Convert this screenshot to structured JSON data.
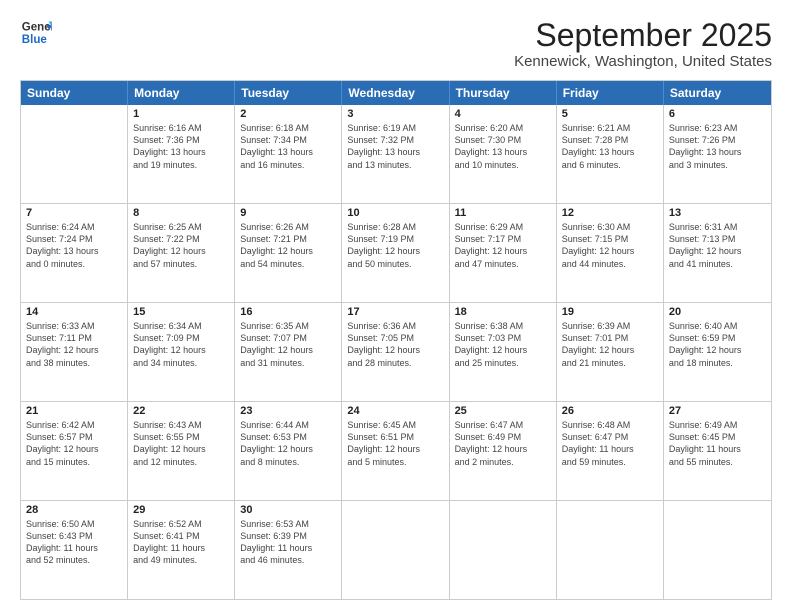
{
  "logo": {
    "general": "General",
    "blue": "Blue"
  },
  "header": {
    "month": "September 2025",
    "location": "Kennewick, Washington, United States"
  },
  "weekdays": [
    "Sunday",
    "Monday",
    "Tuesday",
    "Wednesday",
    "Thursday",
    "Friday",
    "Saturday"
  ],
  "rows": [
    [
      {
        "day": "",
        "lines": []
      },
      {
        "day": "1",
        "lines": [
          "Sunrise: 6:16 AM",
          "Sunset: 7:36 PM",
          "Daylight: 13 hours",
          "and 19 minutes."
        ]
      },
      {
        "day": "2",
        "lines": [
          "Sunrise: 6:18 AM",
          "Sunset: 7:34 PM",
          "Daylight: 13 hours",
          "and 16 minutes."
        ]
      },
      {
        "day": "3",
        "lines": [
          "Sunrise: 6:19 AM",
          "Sunset: 7:32 PM",
          "Daylight: 13 hours",
          "and 13 minutes."
        ]
      },
      {
        "day": "4",
        "lines": [
          "Sunrise: 6:20 AM",
          "Sunset: 7:30 PM",
          "Daylight: 13 hours",
          "and 10 minutes."
        ]
      },
      {
        "day": "5",
        "lines": [
          "Sunrise: 6:21 AM",
          "Sunset: 7:28 PM",
          "Daylight: 13 hours",
          "and 6 minutes."
        ]
      },
      {
        "day": "6",
        "lines": [
          "Sunrise: 6:23 AM",
          "Sunset: 7:26 PM",
          "Daylight: 13 hours",
          "and 3 minutes."
        ]
      }
    ],
    [
      {
        "day": "7",
        "lines": [
          "Sunrise: 6:24 AM",
          "Sunset: 7:24 PM",
          "Daylight: 13 hours",
          "and 0 minutes."
        ]
      },
      {
        "day": "8",
        "lines": [
          "Sunrise: 6:25 AM",
          "Sunset: 7:22 PM",
          "Daylight: 12 hours",
          "and 57 minutes."
        ]
      },
      {
        "day": "9",
        "lines": [
          "Sunrise: 6:26 AM",
          "Sunset: 7:21 PM",
          "Daylight: 12 hours",
          "and 54 minutes."
        ]
      },
      {
        "day": "10",
        "lines": [
          "Sunrise: 6:28 AM",
          "Sunset: 7:19 PM",
          "Daylight: 12 hours",
          "and 50 minutes."
        ]
      },
      {
        "day": "11",
        "lines": [
          "Sunrise: 6:29 AM",
          "Sunset: 7:17 PM",
          "Daylight: 12 hours",
          "and 47 minutes."
        ]
      },
      {
        "day": "12",
        "lines": [
          "Sunrise: 6:30 AM",
          "Sunset: 7:15 PM",
          "Daylight: 12 hours",
          "and 44 minutes."
        ]
      },
      {
        "day": "13",
        "lines": [
          "Sunrise: 6:31 AM",
          "Sunset: 7:13 PM",
          "Daylight: 12 hours",
          "and 41 minutes."
        ]
      }
    ],
    [
      {
        "day": "14",
        "lines": [
          "Sunrise: 6:33 AM",
          "Sunset: 7:11 PM",
          "Daylight: 12 hours",
          "and 38 minutes."
        ]
      },
      {
        "day": "15",
        "lines": [
          "Sunrise: 6:34 AM",
          "Sunset: 7:09 PM",
          "Daylight: 12 hours",
          "and 34 minutes."
        ]
      },
      {
        "day": "16",
        "lines": [
          "Sunrise: 6:35 AM",
          "Sunset: 7:07 PM",
          "Daylight: 12 hours",
          "and 31 minutes."
        ]
      },
      {
        "day": "17",
        "lines": [
          "Sunrise: 6:36 AM",
          "Sunset: 7:05 PM",
          "Daylight: 12 hours",
          "and 28 minutes."
        ]
      },
      {
        "day": "18",
        "lines": [
          "Sunrise: 6:38 AM",
          "Sunset: 7:03 PM",
          "Daylight: 12 hours",
          "and 25 minutes."
        ]
      },
      {
        "day": "19",
        "lines": [
          "Sunrise: 6:39 AM",
          "Sunset: 7:01 PM",
          "Daylight: 12 hours",
          "and 21 minutes."
        ]
      },
      {
        "day": "20",
        "lines": [
          "Sunrise: 6:40 AM",
          "Sunset: 6:59 PM",
          "Daylight: 12 hours",
          "and 18 minutes."
        ]
      }
    ],
    [
      {
        "day": "21",
        "lines": [
          "Sunrise: 6:42 AM",
          "Sunset: 6:57 PM",
          "Daylight: 12 hours",
          "and 15 minutes."
        ]
      },
      {
        "day": "22",
        "lines": [
          "Sunrise: 6:43 AM",
          "Sunset: 6:55 PM",
          "Daylight: 12 hours",
          "and 12 minutes."
        ]
      },
      {
        "day": "23",
        "lines": [
          "Sunrise: 6:44 AM",
          "Sunset: 6:53 PM",
          "Daylight: 12 hours",
          "and 8 minutes."
        ]
      },
      {
        "day": "24",
        "lines": [
          "Sunrise: 6:45 AM",
          "Sunset: 6:51 PM",
          "Daylight: 12 hours",
          "and 5 minutes."
        ]
      },
      {
        "day": "25",
        "lines": [
          "Sunrise: 6:47 AM",
          "Sunset: 6:49 PM",
          "Daylight: 12 hours",
          "and 2 minutes."
        ]
      },
      {
        "day": "26",
        "lines": [
          "Sunrise: 6:48 AM",
          "Sunset: 6:47 PM",
          "Daylight: 11 hours",
          "and 59 minutes."
        ]
      },
      {
        "day": "27",
        "lines": [
          "Sunrise: 6:49 AM",
          "Sunset: 6:45 PM",
          "Daylight: 11 hours",
          "and 55 minutes."
        ]
      }
    ],
    [
      {
        "day": "28",
        "lines": [
          "Sunrise: 6:50 AM",
          "Sunset: 6:43 PM",
          "Daylight: 11 hours",
          "and 52 minutes."
        ]
      },
      {
        "day": "29",
        "lines": [
          "Sunrise: 6:52 AM",
          "Sunset: 6:41 PM",
          "Daylight: 11 hours",
          "and 49 minutes."
        ]
      },
      {
        "day": "30",
        "lines": [
          "Sunrise: 6:53 AM",
          "Sunset: 6:39 PM",
          "Daylight: 11 hours",
          "and 46 minutes."
        ]
      },
      {
        "day": "",
        "lines": []
      },
      {
        "day": "",
        "lines": []
      },
      {
        "day": "",
        "lines": []
      },
      {
        "day": "",
        "lines": []
      }
    ]
  ]
}
